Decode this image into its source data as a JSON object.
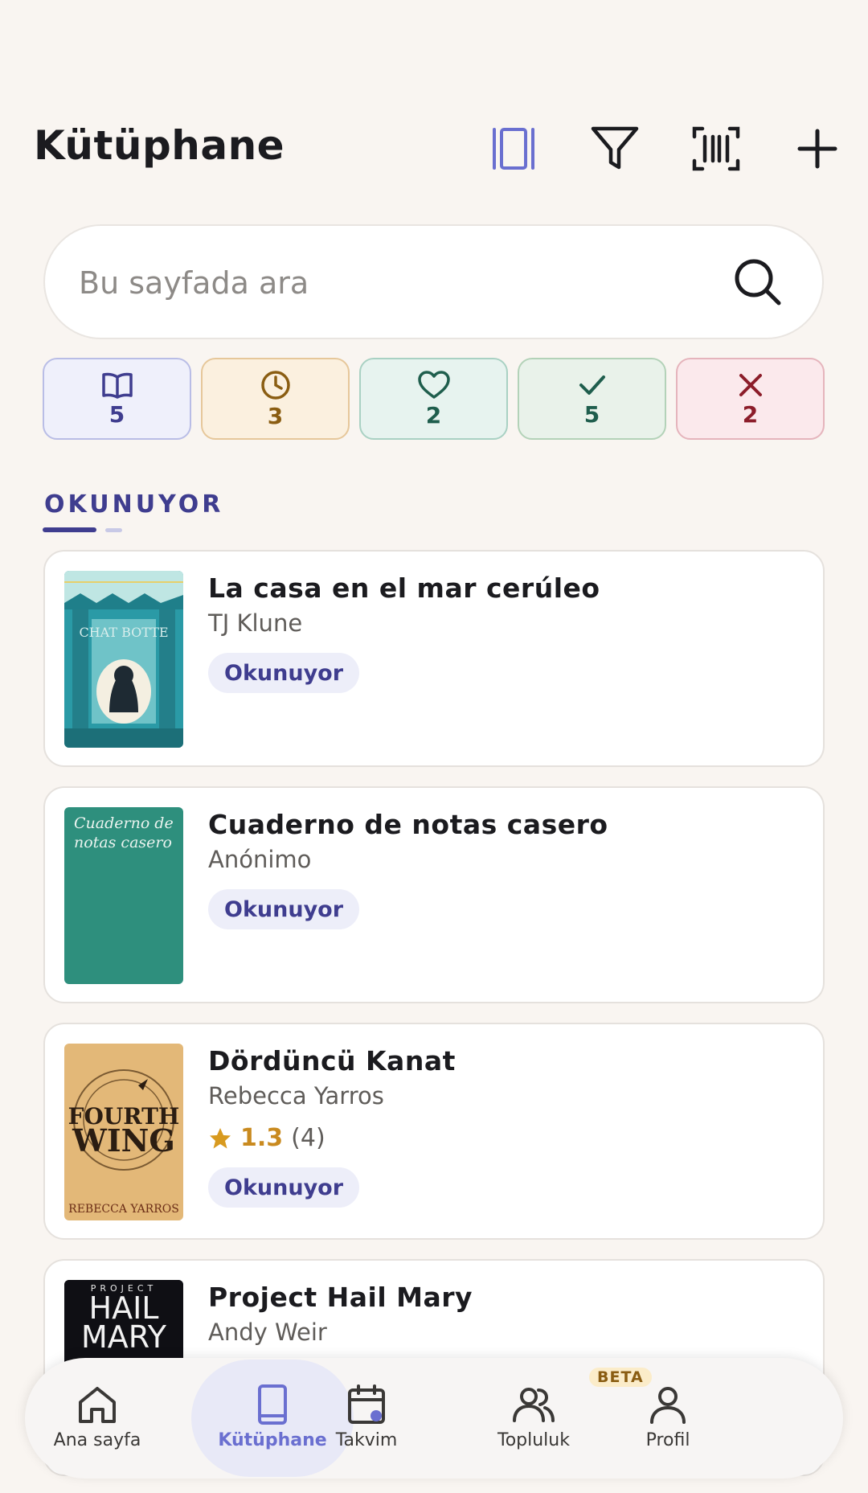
{
  "header": {
    "title": "Kütüphane",
    "actions": [
      "view-toggle-icon",
      "filter-icon",
      "barcode-scan-icon",
      "add-icon"
    ]
  },
  "search": {
    "placeholder": "Bu sayfada ara"
  },
  "status_chips": [
    {
      "icon": "open-book-icon",
      "count": "5",
      "color": "#3f3d8f",
      "bg": "#eff0fb",
      "border": "#b9bde6"
    },
    {
      "icon": "clock-icon",
      "count": "3",
      "color": "#8a5d12",
      "bg": "#fbf0df",
      "border": "#e6c79a"
    },
    {
      "icon": "heart-icon",
      "count": "2",
      "color": "#1f5e4d",
      "bg": "#e7f3ef",
      "border": "#a9d1c3"
    },
    {
      "icon": "check-icon",
      "count": "5",
      "color": "#1f5e4d",
      "bg": "#e9f2ea",
      "border": "#b3d2b8"
    },
    {
      "icon": "close-icon",
      "count": "2",
      "color": "#8c1d2a",
      "bg": "#fbe9ec",
      "border": "#e5b4bc"
    }
  ],
  "section": {
    "tab_label": "OKUNUYOR"
  },
  "books": [
    {
      "title": "La casa en el mar cerúleo",
      "author": "TJ Klune",
      "status": "Okunuyor",
      "cover_text": "CHAT BOTTE"
    },
    {
      "title": "Cuaderno de notas casero",
      "author": "Anónimo",
      "status": "Okunuyor",
      "cover_text": "Cuaderno de notas casero"
    },
    {
      "title": "Dördüncü Kanat",
      "author": "Rebecca Yarros",
      "rating": "1.3",
      "rating_count": "(4)",
      "status": "Okunuyor",
      "cover_text_top": "FOURTH",
      "cover_text_bottom": "WING",
      "cover_author": "REBECCA YARROS"
    },
    {
      "title": "Project Hail Mary",
      "author": "Andy Weir",
      "cover_text_top": "PROJECT",
      "cover_text_mid": "HAIL",
      "cover_text_bottom": "MARY"
    }
  ],
  "bottom_nav": {
    "items": [
      {
        "label": "Ana sayfa",
        "icon": "home-icon"
      },
      {
        "label": "Kütüphane",
        "icon": "book-icon",
        "active": true
      },
      {
        "label": "Takvim",
        "icon": "calendar-icon"
      },
      {
        "label": "Topluluk",
        "icon": "community-icon",
        "badge": "BETA"
      },
      {
        "label": "Profil",
        "icon": "profile-icon"
      }
    ]
  },
  "colors": {
    "accent": "#3f3d8f",
    "background": "#f9f5f1",
    "rating_star": "#c98a1f"
  }
}
